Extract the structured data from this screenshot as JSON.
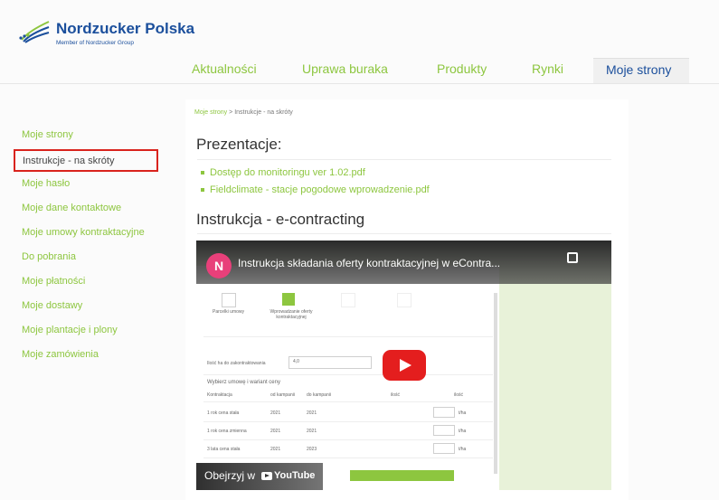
{
  "brand": {
    "name": "Nordzucker Polska",
    "tagline": "Member of Nordzucker Group",
    "logo_icon": "nordzucker-logo-mark"
  },
  "colors": {
    "accent_green": "#8dc63f",
    "brand_blue": "#1b4f9c",
    "highlight_red": "#d9231d",
    "youtube_red": "#e41e1e"
  },
  "nav": {
    "items": [
      {
        "label": "Aktualności"
      },
      {
        "label": "Uprawa buraka"
      },
      {
        "label": "Produkty"
      },
      {
        "label": "Rynki"
      },
      {
        "label": "Moje strony",
        "active": true
      }
    ]
  },
  "breadcrumb": {
    "root": "Moje strony",
    "separator": ">",
    "current": "Instrukcje - na skróty"
  },
  "sidebar": {
    "items": [
      {
        "label": "Moje strony"
      },
      {
        "label": "Instrukcje - na skróty",
        "active": true
      },
      {
        "label": "Moje hasło"
      },
      {
        "label": "Moje dane kontaktowe"
      },
      {
        "label": "Moje umowy kontraktacyjne"
      },
      {
        "label": "Do pobrania"
      },
      {
        "label": "Moje płatności"
      },
      {
        "label": "Moje dostawy"
      },
      {
        "label": "Moje plantacje i plony"
      },
      {
        "label": "Moje zamówienia"
      }
    ]
  },
  "main": {
    "section1_title": "Prezentacje:",
    "documents": [
      {
        "label": "Dostęp do monitoringu ver 1.02.pdf"
      },
      {
        "label": "Fieldclimate - stacje pogodowe wprowadzenie.pdf"
      }
    ],
    "section2_title": "Instrukcja - e-contracting"
  },
  "video": {
    "channel_initial": "N",
    "title": "Instrukcja składania oferty kontraktacyjnej w eContra...",
    "watch_label": "Obejrzyj w",
    "platform": "YouTube",
    "copy_icon": "copy-link-icon",
    "play_icon": "youtube-play-icon",
    "sheet": {
      "steps": [
        "Parcelki umowy",
        "Wprowadzanie oferty kontraktacyjnej"
      ],
      "field_label": "Ilość ha do zakontraktowania",
      "field_value": "4,0",
      "section_label": "Wybierz umowę i wariant ceny",
      "columns": [
        "Kontraktacja",
        "od kampanii",
        "do kampanii",
        "ilość",
        "ilość"
      ],
      "rows": [
        {
          "name": "1 rok cena stała",
          "from": "2021",
          "to": "2021",
          "unit": "t/ha"
        },
        {
          "name": "1 rok cena zmienna",
          "from": "2021",
          "to": "2021",
          "unit": "t/ha"
        },
        {
          "name": "3 lata cena stała",
          "from": "2021",
          "to": "2023",
          "unit": "t/ha"
        }
      ]
    }
  }
}
